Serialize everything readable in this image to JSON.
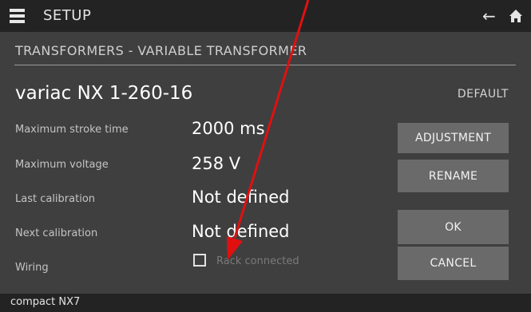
{
  "header": {
    "title": "SETUP",
    "icons": [
      "menu-icon",
      "back-arrow-icon",
      "home-icon"
    ]
  },
  "breadcrumb": "TRANSFORMERS - VARIABLE TRANSFORMER",
  "device": {
    "name": "variac NX 1-260-16",
    "default_label": "DEFAULT"
  },
  "fields": {
    "max_stroke_time": {
      "label": "Maximum stroke time",
      "value": "2000 ms"
    },
    "max_voltage": {
      "label": "Maximum voltage",
      "value": "258 V"
    },
    "last_calibration": {
      "label": "Last calibration",
      "value": "Not defined"
    },
    "next_calibration": {
      "label": "Next calibration",
      "value": "Not defined"
    },
    "wiring": {
      "label": "Wiring",
      "checkbox_label": "Rack connected",
      "checked": false
    }
  },
  "buttons": {
    "adjustment": "ADJUSTMENT",
    "rename": "RENAME",
    "ok": "OK",
    "cancel": "CANCEL"
  },
  "footer": "compact NX7",
  "colors": {
    "background": "#3f3f3f",
    "bars": "#232323",
    "button": "#6a6a6a",
    "annotation_arrow": "#e01010"
  }
}
